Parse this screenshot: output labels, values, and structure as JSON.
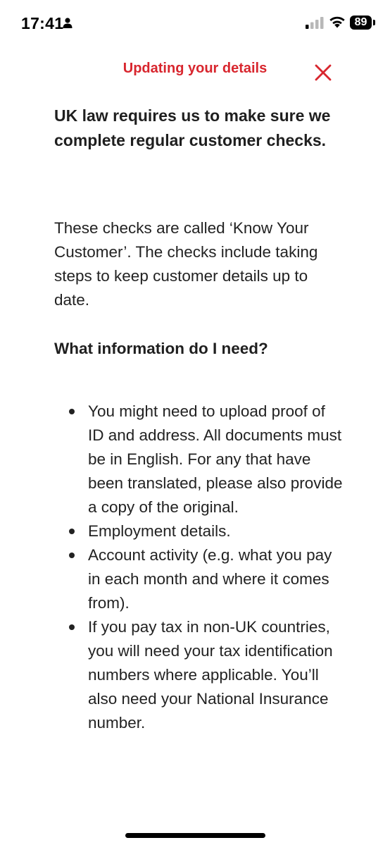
{
  "status_bar": {
    "time": "17:41",
    "battery_level": "89",
    "icons": [
      "person-icon",
      "signal-icon",
      "wifi-icon",
      "battery-icon"
    ]
  },
  "header": {
    "title": "Updating your details",
    "close_icon": "close-icon",
    "accent_color": "#d8262e"
  },
  "content": {
    "intro_heading": "UK law requires us to make sure we complete regular customer checks.",
    "body_text": "These checks are called ‘Know Your Customer’. The checks include taking steps to keep customer details up to date.",
    "subheading": "What information do I need?",
    "bullets": [
      "You might need to upload proof of ID and address. All documents must be in English. For any that have been translated, please also provide a copy of the original.",
      "Employment details.",
      "Account activity (e.g. what you pay in each month and where it comes from).",
      "If you pay tax in non-UK countries, you will need your tax identification numbers where applicable. You’ll also need your National Insurance number."
    ]
  }
}
